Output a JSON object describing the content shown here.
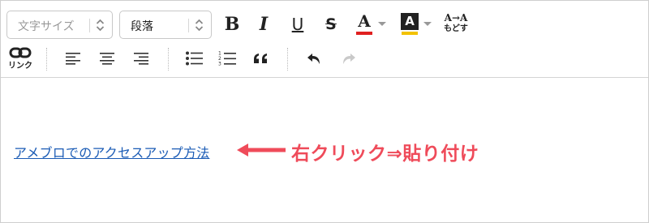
{
  "toolbar": {
    "font_size_select": {
      "placeholder": "文字サイズ"
    },
    "paragraph_select": {
      "value": "段落"
    },
    "bold_label": "B",
    "italic_label": "I",
    "underline_label": "U",
    "strike_label": "S",
    "text_color": {
      "label": "A",
      "color": "#e02020"
    },
    "bg_color": {
      "label": "A",
      "color": "#f2c200"
    },
    "reset_format": {
      "top": "A→A",
      "bottom": "もどす"
    },
    "link": {
      "label": "リンク"
    },
    "icons": [
      "link-icon",
      "align-left-icon",
      "align-center-icon",
      "align-right-icon",
      "bulleted-list-icon",
      "numbered-list-icon",
      "blockquote-icon",
      "undo-icon",
      "redo-icon"
    ]
  },
  "editor": {
    "link_text": "アメブロでのアクセスアップ方法"
  },
  "annotation": {
    "text": "右クリック⇒貼り付け",
    "color": "#ef4b5a"
  }
}
